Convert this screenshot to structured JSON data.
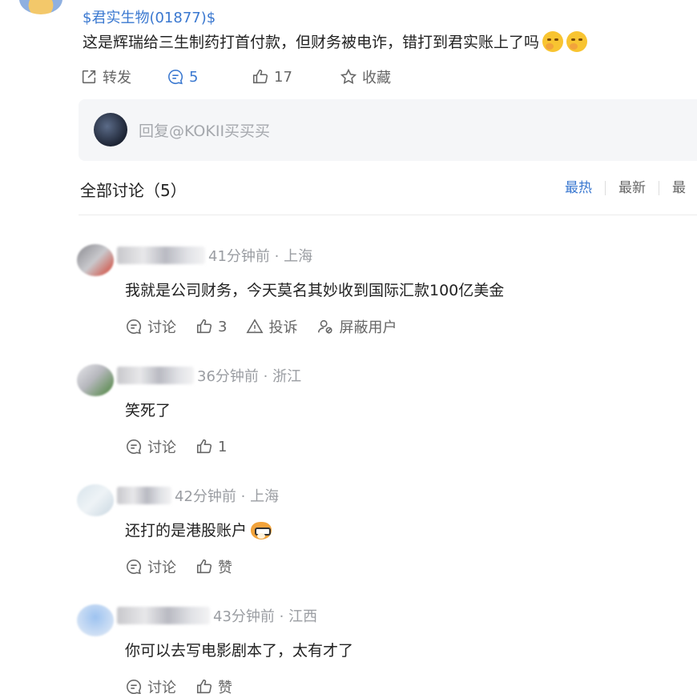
{
  "post": {
    "stock_tag": "$君实生物(01877)$",
    "text": "这是辉瑞给三生制药打首付款，但财务被电诈，错打到君实账上了吗",
    "emojis": [
      "thinking-face",
      "thinking-face"
    ],
    "actions": {
      "share_label": "转发",
      "comment_count": "5",
      "like_count": "17",
      "favorite_label": "收藏"
    }
  },
  "reply": {
    "placeholder": "回复@KOKII买买买"
  },
  "discussion": {
    "header": "全部讨论（5）",
    "sort_tabs": [
      "最热",
      "最新",
      "最"
    ]
  },
  "comments": [
    {
      "meta": "41分钟前 · 上海",
      "text": "我就是公司财务，今天莫名其妙收到国际汇款100亿美金",
      "actions": {
        "discuss_label": "讨论",
        "like_value": "3",
        "report_label": "投诉",
        "block_label": "屏蔽用户"
      }
    },
    {
      "meta": "36分钟前 · 浙江",
      "text": "笑死了",
      "actions": {
        "discuss_label": "讨论",
        "like_value": "1"
      }
    },
    {
      "meta": "42分钟前 · 上海",
      "text": "还打的是港股账户",
      "emoji": "doge-face",
      "actions": {
        "discuss_label": "讨论",
        "like_value": "赞"
      }
    },
    {
      "meta": "43分钟前 · 江西",
      "text": "你可以去写电影剧本了，太有才了",
      "actions": {
        "discuss_label": "讨论",
        "like_value": "赞"
      }
    }
  ],
  "colors": {
    "accent": "#3a78d0",
    "muted": "#9a9da2",
    "text": "#222222"
  }
}
